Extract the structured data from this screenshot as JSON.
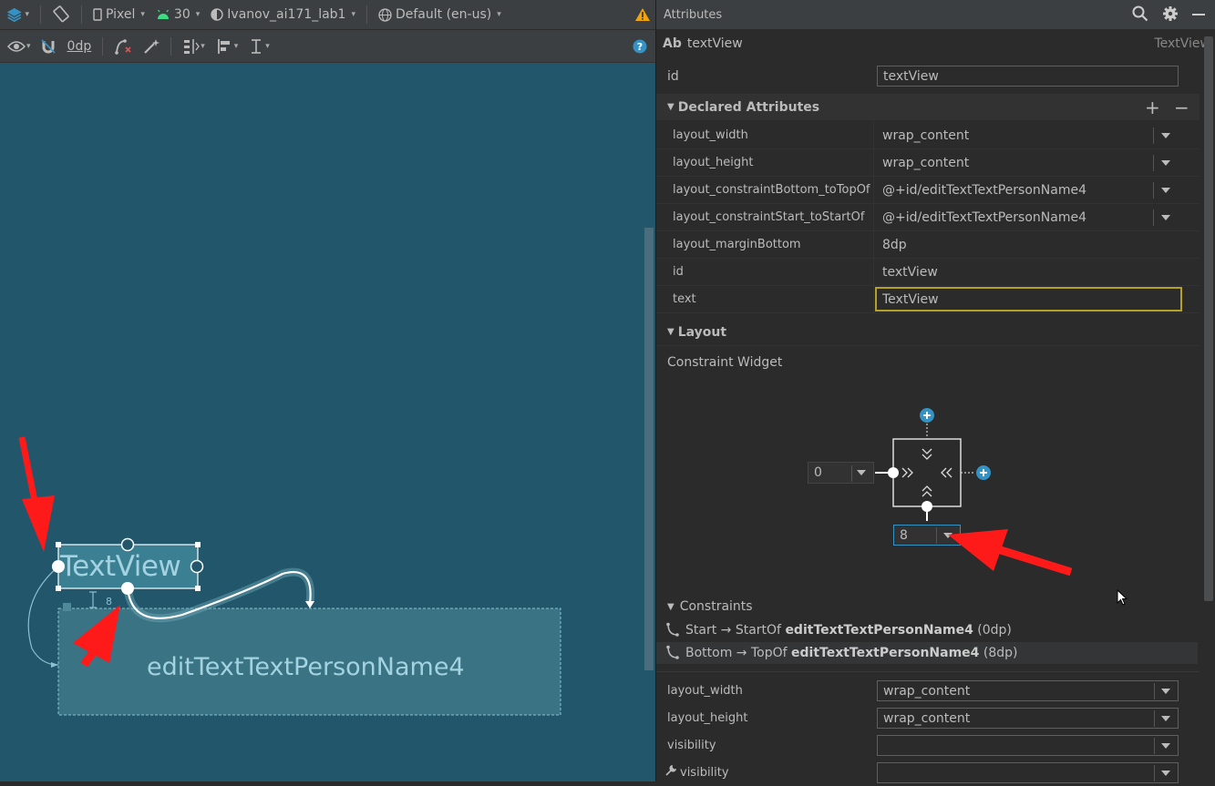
{
  "toolbar": {
    "device": "Pixel",
    "api_level": "30",
    "theme": "Ivanov_ai171_lab1",
    "locale": "Default (en-us)",
    "margin": "0dp"
  },
  "canvas": {
    "textview_label": "TextView",
    "edittext_label": "editTextTextPersonName4",
    "margin_label": "8"
  },
  "attributes": {
    "panel_title": "Attributes",
    "component_prefix": "Ab",
    "component_name": "textView",
    "component_type": "TextView",
    "id_label": "id",
    "id_value": "textView",
    "declared_title": "Declared Attributes",
    "declared": [
      {
        "key": "layout_width",
        "value": "wrap_content"
      },
      {
        "key": "layout_height",
        "value": "wrap_content"
      },
      {
        "key": "layout_constraintBottom_toTopOf",
        "value": "@+id/editTextTextPersonName4"
      },
      {
        "key": "layout_constraintStart_toStartOf",
        "value": "@+id/editTextTextPersonName4"
      },
      {
        "key": "layout_marginBottom",
        "value": "8dp"
      },
      {
        "key": "id",
        "value": "textView"
      },
      {
        "key": "text",
        "value": "TextView"
      }
    ],
    "layout_title": "Layout",
    "constraint_widget_label": "Constraint Widget",
    "start_margin": "0",
    "bottom_margin": "8",
    "constraints_title": "Constraints",
    "constraints": [
      {
        "prefix": "Start → StartOf ",
        "target": "editTextTextPersonName4",
        "suffix": " (0dp)"
      },
      {
        "prefix": "Bottom → TopOf ",
        "target": "editTextTextPersonName4",
        "suffix": " (8dp)"
      }
    ],
    "bottom_attrs": [
      {
        "key": "layout_width",
        "value": "wrap_content"
      },
      {
        "key": "layout_height",
        "value": "wrap_content"
      },
      {
        "key": "visibility",
        "value": ""
      },
      {
        "key": "visibility",
        "value": ""
      }
    ]
  },
  "colors": {
    "canvas_bg": "#21566b",
    "accent_blue": "#3592c4",
    "warning": "#f0a30a",
    "highlight_border": "#b5a129",
    "arrow_red": "#ff1a1a"
  }
}
